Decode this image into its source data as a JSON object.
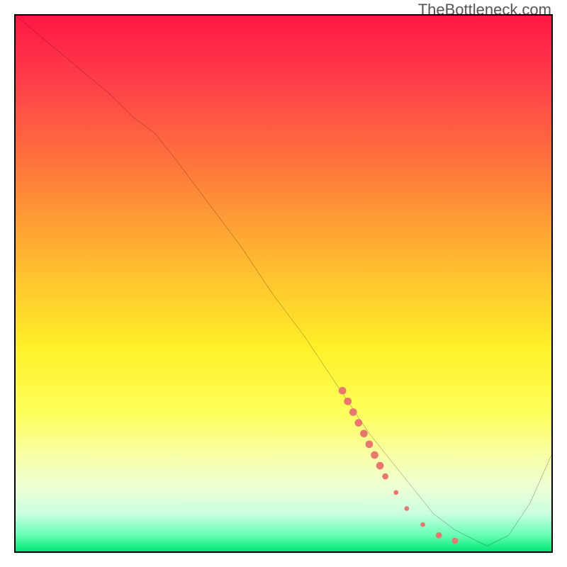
{
  "watermark": "TheBottleneck.com",
  "colors": {
    "curve_stroke": "#000000",
    "marker_fill": "#e9766f",
    "marker_stroke": "#e9766f"
  },
  "chart_data": {
    "type": "line",
    "title": "",
    "xlabel": "",
    "ylabel": "",
    "xlim": [
      0,
      100
    ],
    "ylim": [
      0,
      100
    ],
    "grid": false,
    "note": "No numeric tick labels are visible; x and y are normalized 0–100 from the plot box borders. Curve points are (x, y) with y=0 meaning the bottom (optimum, green).",
    "series": [
      {
        "name": "bottleneck_curve",
        "x": [
          0,
          6,
          12,
          18,
          22,
          26,
          30,
          36,
          42,
          48,
          54,
          58,
          62,
          66,
          70,
          74,
          78,
          82,
          86,
          88,
          92,
          96,
          100
        ],
        "y": [
          100,
          95,
          90,
          85,
          81,
          78,
          73,
          65,
          57,
          48,
          40,
          34,
          28,
          22,
          17,
          12,
          7,
          4,
          2,
          1,
          3,
          9,
          18
        ]
      }
    ],
    "markers": {
      "name": "highlight_cluster",
      "note": "Thick segment of overlapping markers along the curve in the lower-right region.",
      "points": [
        {
          "x": 61,
          "y": 30,
          "r": 5
        },
        {
          "x": 62,
          "y": 28,
          "r": 5
        },
        {
          "x": 63,
          "y": 26,
          "r": 5
        },
        {
          "x": 64,
          "y": 24,
          "r": 5
        },
        {
          "x": 65,
          "y": 22,
          "r": 5
        },
        {
          "x": 66,
          "y": 20,
          "r": 5
        },
        {
          "x": 67,
          "y": 18,
          "r": 5
        },
        {
          "x": 68,
          "y": 16,
          "r": 5
        },
        {
          "x": 69,
          "y": 14,
          "r": 4
        },
        {
          "x": 71,
          "y": 11,
          "r": 3
        },
        {
          "x": 73,
          "y": 8,
          "r": 3
        },
        {
          "x": 76,
          "y": 5,
          "r": 3
        },
        {
          "x": 79,
          "y": 3,
          "r": 4
        },
        {
          "x": 82,
          "y": 2,
          "r": 4
        }
      ]
    }
  }
}
